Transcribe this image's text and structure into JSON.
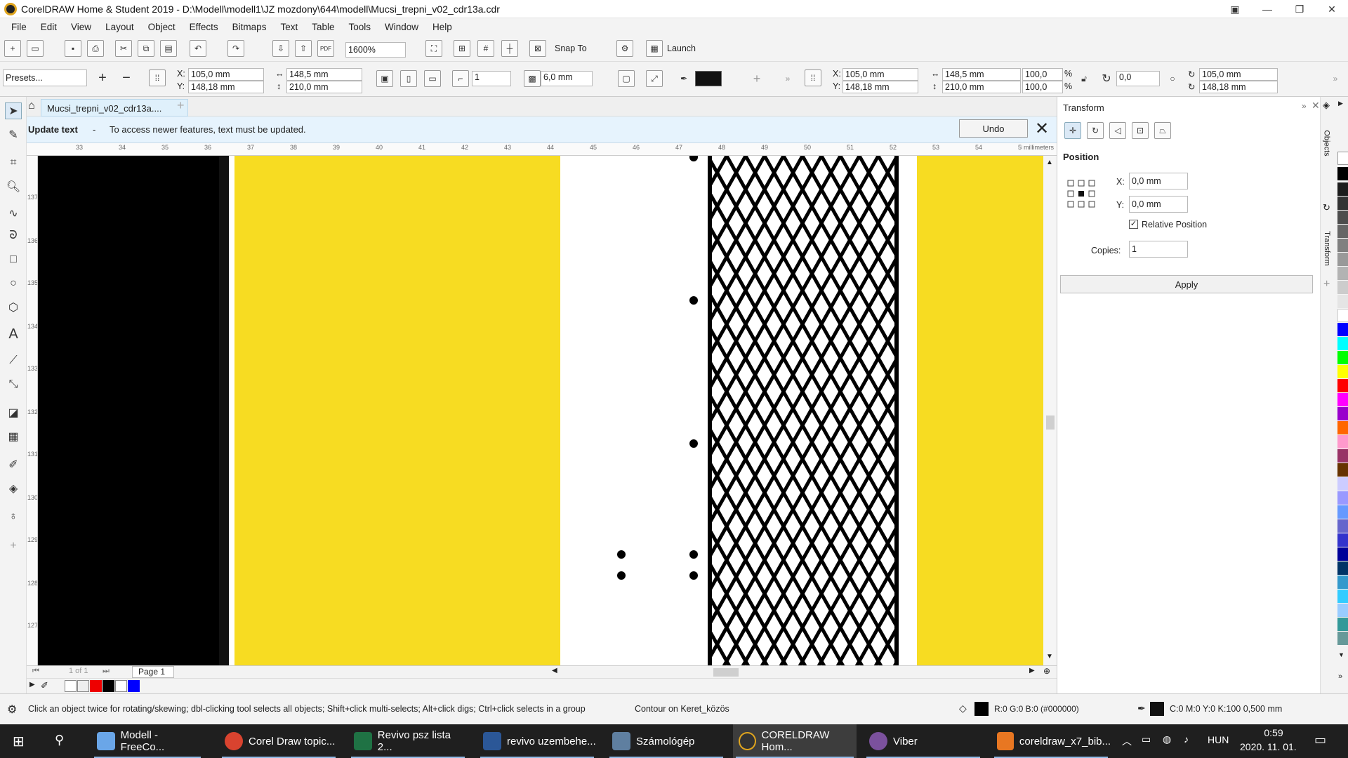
{
  "window": {
    "title": "CorelDRAW Home & Student 2019 - D:\\Modell\\modell1\\JZ mozdony\\644\\modell\\Mucsi_trepni_v02_cdr13a.cdr"
  },
  "menu": [
    "File",
    "Edit",
    "View",
    "Layout",
    "Object",
    "Effects",
    "Bitmaps",
    "Text",
    "Table",
    "Tools",
    "Window",
    "Help"
  ],
  "toolbar1": {
    "zoom": "1600%",
    "snap": "Snap To",
    "launch": "Launch",
    "pdf": "PDF"
  },
  "toolbar2": {
    "presets": "Presets...",
    "x_label": "X:",
    "x": "105,0 mm",
    "y_label": "Y:",
    "y": "148,18 mm",
    "w": "148,5 mm",
    "h": "210,0 mm",
    "copies": "1",
    "nudge": "6,0 mm",
    "x2": "105,0 mm",
    "y2": "148,18 mm",
    "w2": "148,5 mm",
    "h2": "210,0 mm",
    "sx": "100,0",
    "sy": "100,0",
    "pct": "%",
    "angle": "0,0",
    "cx": "105,0 mm",
    "cy": "148,18 mm"
  },
  "tab": {
    "name": "Mucsi_trepni_v02_cdr13a...."
  },
  "notification": {
    "title": "Update text",
    "dash": "-",
    "message": "To access newer features, text must be updated.",
    "undo": "Undo"
  },
  "ruler": {
    "unit": "millimeters",
    "h": [
      "33",
      "34",
      "35",
      "36",
      "37",
      "38",
      "39",
      "40",
      "41",
      "42",
      "43",
      "44",
      "45",
      "46",
      "47",
      "48",
      "49",
      "50",
      "51",
      "52",
      "53",
      "54",
      "55"
    ],
    "v": [
      "137",
      "136",
      "135",
      "134",
      "133",
      "132",
      "131",
      "130",
      "129",
      "128",
      "127"
    ]
  },
  "page": {
    "nav": "1 of 1",
    "label": "Page 1"
  },
  "docker": {
    "title": "Transform",
    "section": "Position",
    "x_label": "X:",
    "x": "0,0 mm",
    "y_label": "Y:",
    "y": "0,0 mm",
    "relative": "Relative Position",
    "copies_label": "Copies:",
    "copies": "1",
    "apply": "Apply",
    "tab_objects": "Objects",
    "tab_transform": "Transform"
  },
  "status": {
    "hint": "Click an object twice for rotating/skewing; dbl-clicking tool selects all objects; Shift+click multi-selects; Alt+click digs; Ctrl+click selects in a group",
    "contour": "Contour on Keret_közös",
    "fill": "R:0 G:0 B:0 (#000000)",
    "outline": "C:0 M:0 Y:0 K:100  0,500 mm"
  },
  "taskbar": {
    "items": [
      "Modell - FreeCo...",
      "Corel Draw topic...",
      "Revivo psz lista 2...",
      "revivo uzembehe...",
      "Számológép",
      "CORELDRAW Hom...",
      "Viber",
      "coreldraw_x7_bib..."
    ],
    "lang": "HUN",
    "time": "0:59",
    "date": "2020. 11. 01."
  },
  "colors": {
    "accent": "#1e88c9",
    "yellow": "#f7dc22",
    "black": "#000000"
  }
}
